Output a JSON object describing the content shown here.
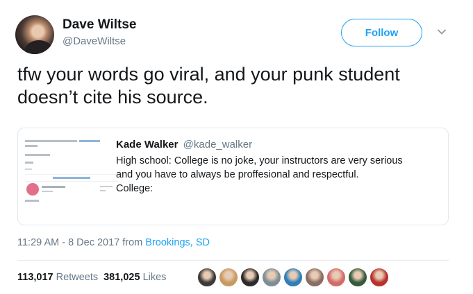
{
  "tweet": {
    "author_name": "Dave Wiltse",
    "author_handle": "@DaveWiltse",
    "follow_label": "Follow",
    "text": "tfw your words go viral, and your punk student doesn’t cite his source.",
    "timestamp": "11:29 AM - 8 Dec 2017 from ",
    "location": "Brookings, SD",
    "retweets_count": "113,017",
    "retweets_label": "Retweets",
    "likes_count": "381,025",
    "likes_label": "Likes"
  },
  "quote": {
    "author_name": "Kade Walker",
    "author_handle": "@kade_walker",
    "line1": "High school: College is no joke, your instructors are very serious",
    "line2": "and you have to always be proffesional and respectful.",
    "line3": "College:"
  },
  "likers": [
    {
      "name": "liker-avatar-1",
      "color": "#3d3a38"
    },
    {
      "name": "liker-avatar-2",
      "color": "#c89a63"
    },
    {
      "name": "liker-avatar-3",
      "color": "#2b2b2b"
    },
    {
      "name": "liker-avatar-4",
      "color": "#7d8f96"
    },
    {
      "name": "liker-avatar-5",
      "color": "#2f7fb6"
    },
    {
      "name": "liker-avatar-6",
      "color": "#8a6e62"
    },
    {
      "name": "liker-avatar-7",
      "color": "#d46b6b"
    },
    {
      "name": "liker-avatar-8",
      "color": "#355b3c"
    },
    {
      "name": "liker-avatar-9",
      "color": "#b8322d"
    }
  ],
  "colors": {
    "accent": "#1da1f2",
    "text": "#14171a",
    "secondary": "#657786"
  }
}
